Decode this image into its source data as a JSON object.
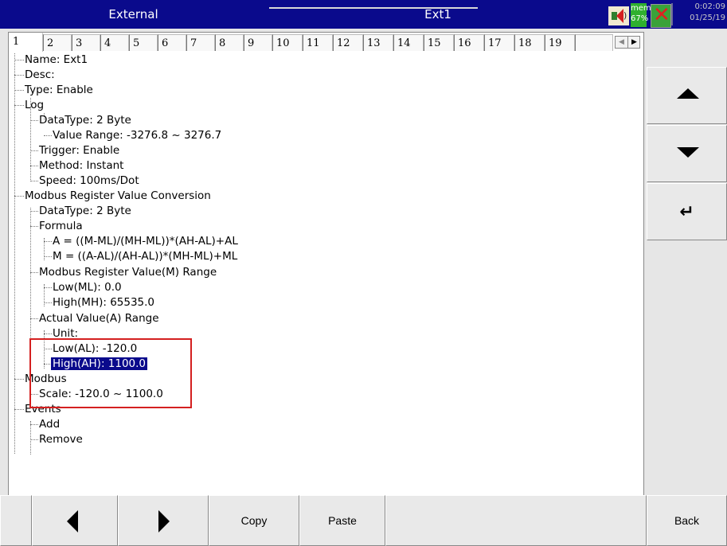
{
  "titlebar": {
    "left_title": "External",
    "center_title": "Ext1",
    "mem_label": "mem",
    "mem_percent": "67%",
    "time": "0:02:09",
    "date": "01/25/19"
  },
  "tabs": [
    "1",
    "2",
    "3",
    "4",
    "5",
    "6",
    "7",
    "8",
    "9",
    "10",
    "11",
    "12",
    "13",
    "14",
    "15",
    "16",
    "17",
    "18",
    "19"
  ],
  "active_tab": "1",
  "tree": {
    "name": "Name: Ext1",
    "desc": "Desc:",
    "type": "Type: Enable",
    "log": "Log",
    "log_datatype": "DataType: 2 Byte",
    "log_value_range": "Value Range: -3276.8 ~ 3276.7",
    "log_trigger": "Trigger: Enable",
    "log_method": "Method: Instant",
    "log_speed": "Speed: 100ms/Dot",
    "modbus_conv": "Modbus Register Value Conversion",
    "conv_datatype": "DataType: 2 Byte",
    "formula": "Formula",
    "formula_a": "A = ((M-ML)/(MH-ML))*(AH-AL)+AL",
    "formula_m": "M = ((A-AL)/(AH-AL))*(MH-ML)+ML",
    "m_range": "Modbus Register Value(M) Range",
    "m_low": "Low(ML): 0.0",
    "m_high": "High(MH): 65535.0",
    "a_range": "Actual Value(A) Range",
    "a_unit": "Unit:",
    "a_low": "Low(AL): -120.0",
    "a_high": "High(AH): 1100.0",
    "modbus": "Modbus",
    "scale": "Scale: -120.0 ~ 1100.0",
    "events": "Events",
    "events_add": "Add",
    "events_remove": "Remove"
  },
  "bottom": {
    "copy": "Copy",
    "paste": "Paste",
    "back": "Back"
  },
  "colors": {
    "titlebar": "#0a0a8c",
    "selection": "#0a0a8c",
    "highlight_box": "#d42020",
    "mem_badge": "#2fb02f"
  },
  "icons": [
    "speaker-icon",
    "usb-disabled-icon",
    "up-arrow-icon",
    "down-arrow-icon",
    "enter-icon",
    "left-arrow-icon",
    "right-arrow-icon"
  ]
}
